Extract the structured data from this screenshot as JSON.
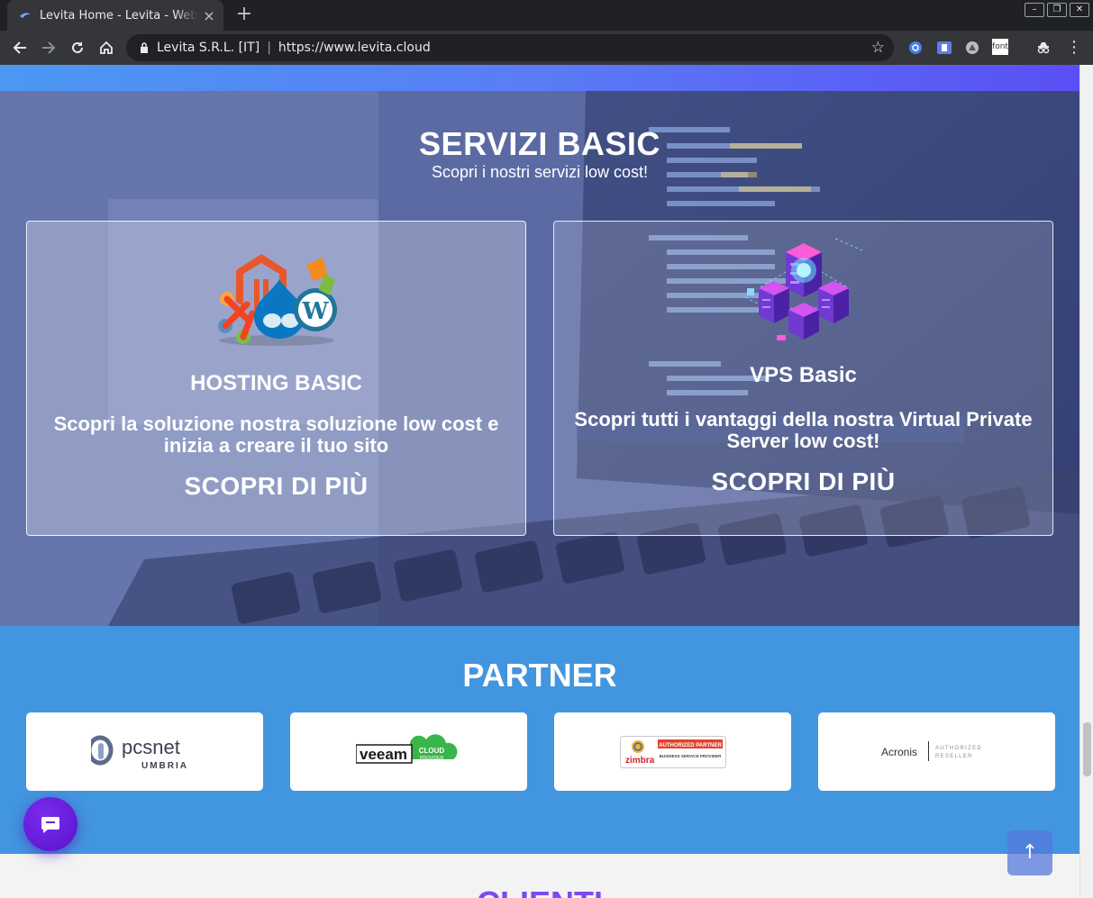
{
  "browser": {
    "tab_title": "Levita Home - Levita - Web",
    "tab_close": "×",
    "new_tab": "+",
    "site_identity": "Levita S.R.L. [IT]",
    "url": "https://www.levita.cloud",
    "omnibox_separator": "|",
    "window_buttons": [
      "–",
      "❐",
      "✕"
    ],
    "extensions": [
      "account-icon",
      "ublock-icon",
      "speedtest-icon",
      "fonts-icon",
      "incognito-icon"
    ],
    "ext_fonts_label": "font"
  },
  "colors": {
    "gradient_start": "#4b98f3",
    "gradient_end": "#5a4ff5",
    "partner_bg": "#4295df",
    "chat_button": "#6a1fe0",
    "clients_title": "#7b4bf0"
  },
  "services": {
    "title": "SERVIZI BASIC",
    "subtitle": "Scopri i nostri servizi low cost!",
    "cards": [
      {
        "title": "HOSTING BASIC",
        "description": "Scopri la soluzione nostra soluzione low cost e inizia a creare il tuo sito",
        "cta": "SCOPRI DI PIÙ",
        "icon": "cms-logos-icon"
      },
      {
        "title": "VPS Basic",
        "description": "Scopri tutti i vantaggi della nostra Virtual Private Server low cost!",
        "cta": "SCOPRI DI PIÙ",
        "icon": "server-isometric-icon"
      }
    ]
  },
  "partner": {
    "title": "PARTNER",
    "logos": [
      {
        "name": "pcsnet",
        "sub": "UMBRIA"
      },
      {
        "name": "veeam",
        "badge": "CLOUD",
        "badge_sub": "PROVIDER"
      },
      {
        "name": "zimbra",
        "badge": "AUTHORIZED PARTNER",
        "badge_sub": "BUSINESS SERVICE PROVIDER"
      },
      {
        "name": "Acronis",
        "badge": "AUTHORIZED",
        "badge_sub": "RESELLER"
      }
    ]
  },
  "clients": {
    "title": "CLIENTI"
  },
  "scroll_top_label": "↑"
}
